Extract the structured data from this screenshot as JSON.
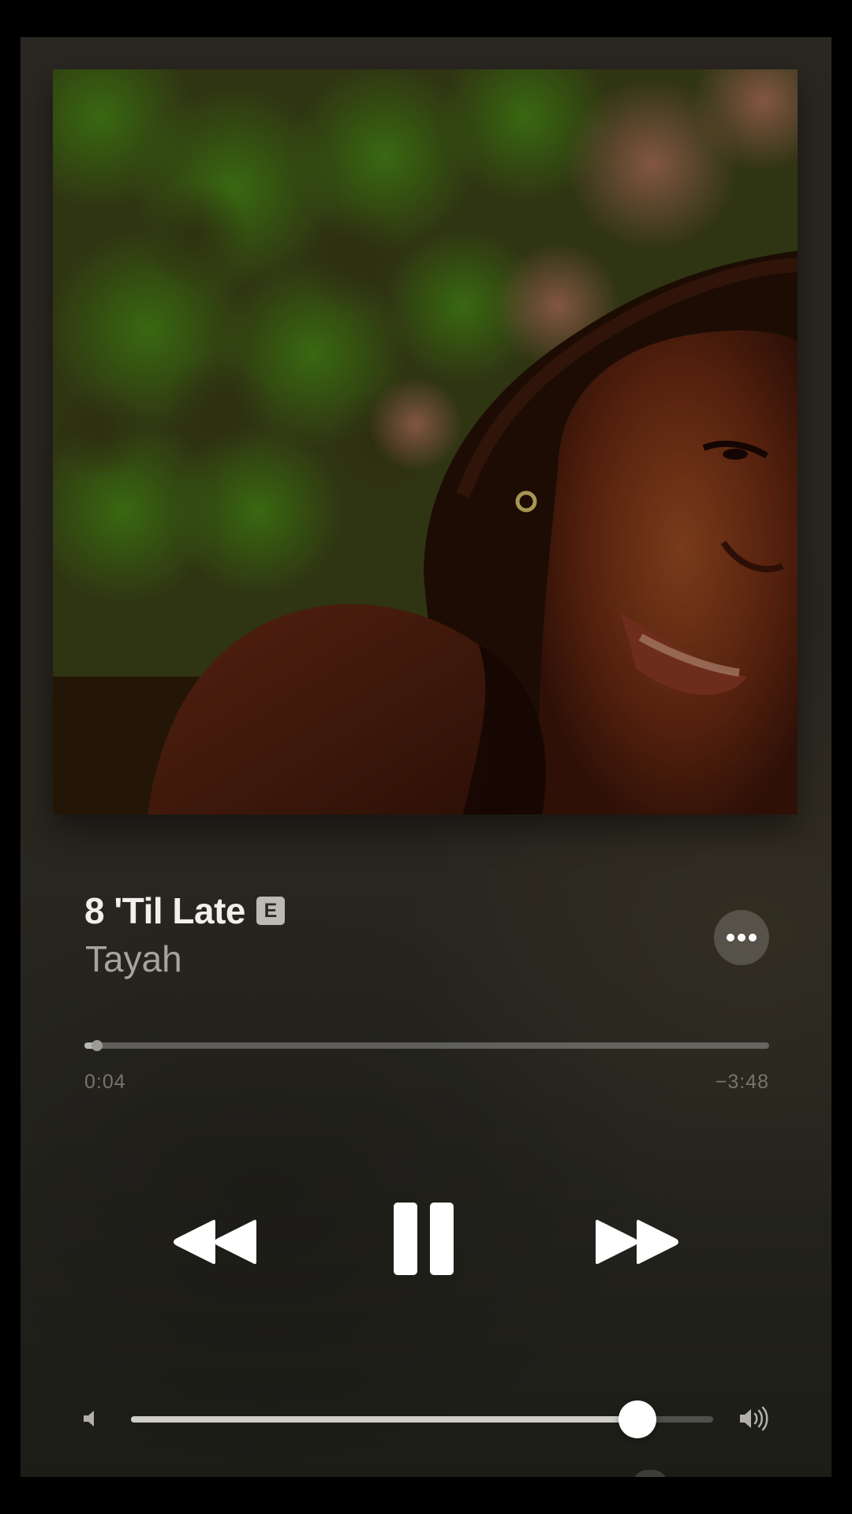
{
  "now_playing": {
    "title": "8 'Til Late",
    "explicit_badge": "E",
    "artist": "Tayah",
    "artwork_icon": "album-artwork-photo"
  },
  "progress": {
    "elapsed": "0:04",
    "remaining": "−3:48",
    "fraction": 0.018
  },
  "controls": {
    "more_icon": "ellipsis-icon",
    "rewind_icon": "rewind-icon",
    "pause_icon": "pause-icon",
    "forward_icon": "fast-forward-icon"
  },
  "volume": {
    "level": 0.87,
    "low_icon": "speaker-low-icon",
    "high_icon": "speaker-high-icon"
  },
  "colors": {
    "background": "#2a2722",
    "title": "#f2f0ec",
    "artist": "#a7a49d",
    "time": "#77746d"
  }
}
